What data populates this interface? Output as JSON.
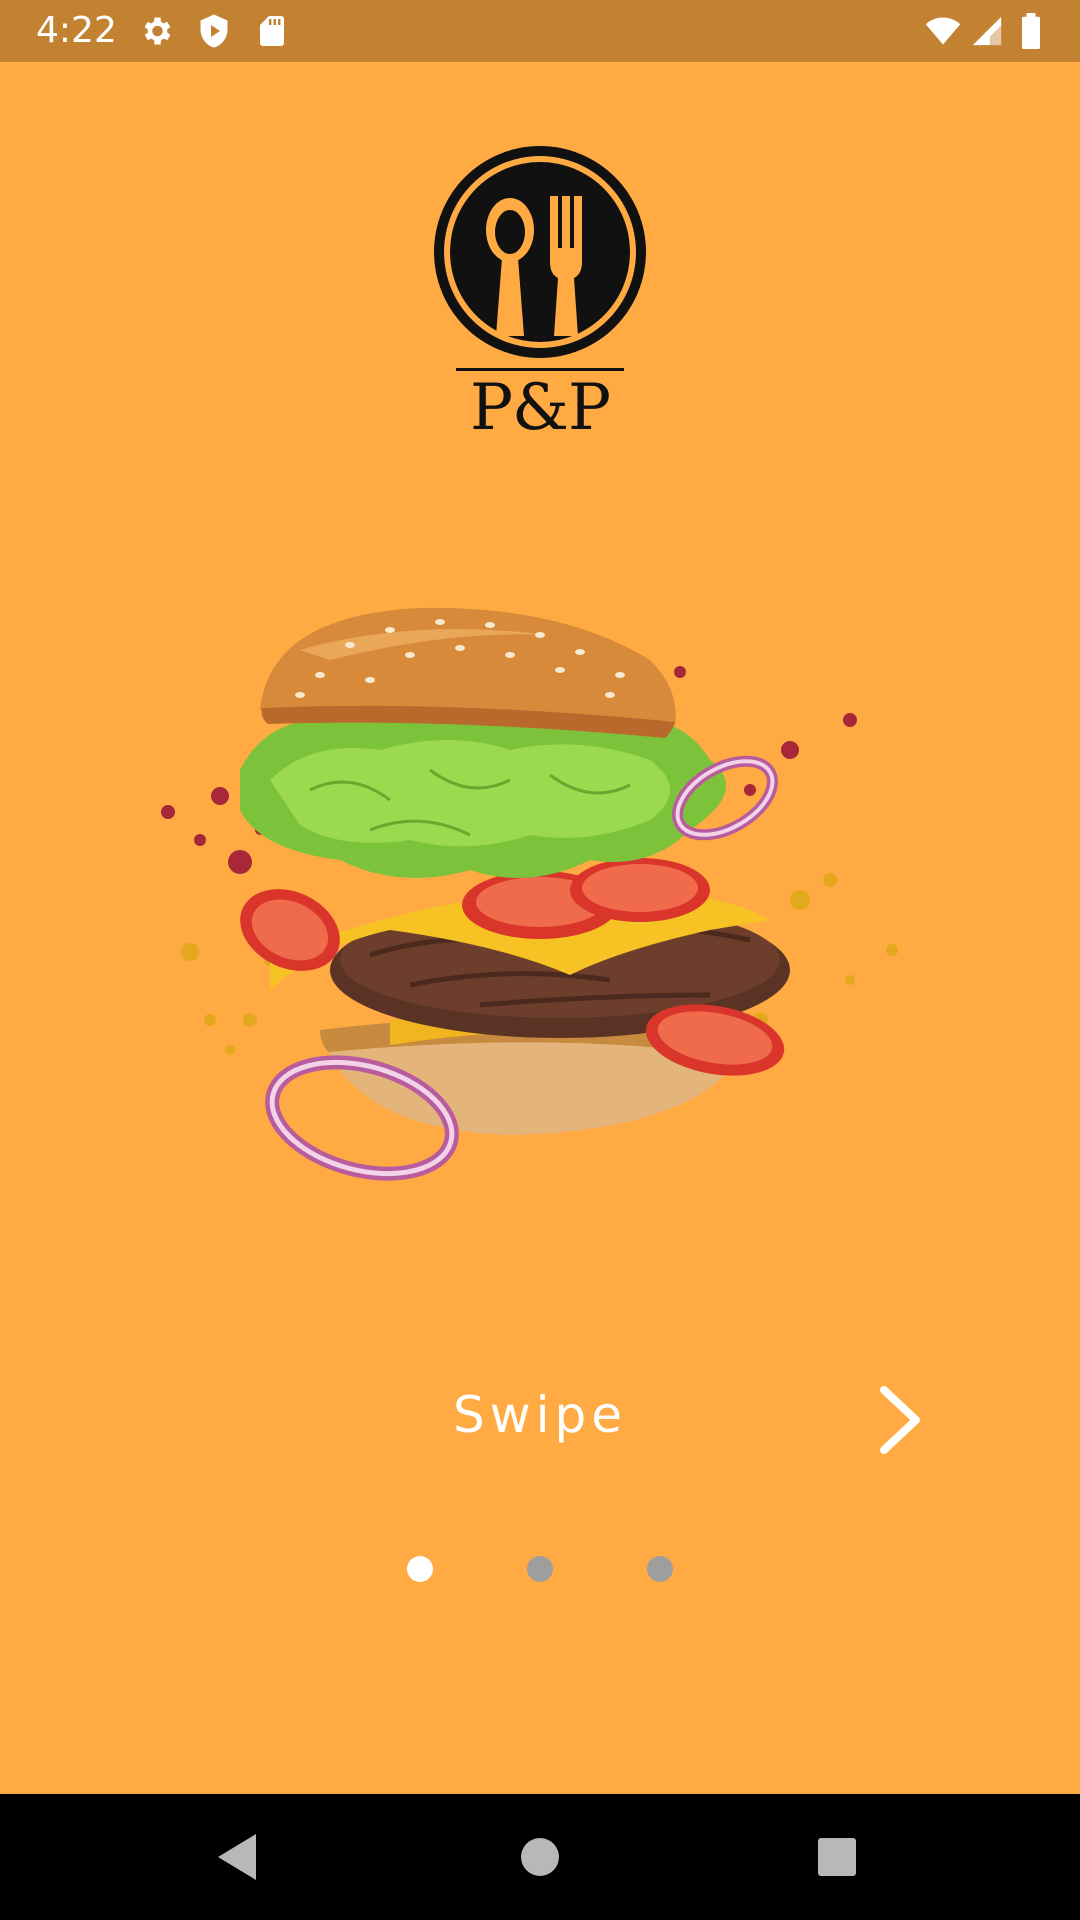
{
  "status_bar": {
    "time": "4:22",
    "background": "#C38232",
    "icons_left": [
      "gear-icon",
      "shield-play-icon",
      "sd-card-icon"
    ],
    "icons_right": [
      "wifi-icon",
      "signal-icon",
      "battery-icon"
    ]
  },
  "theme": {
    "background": "#FFAA42",
    "dot_active": "#FFFFFF",
    "dot_inactive": "#9E9E9E"
  },
  "logo": {
    "icon": "spoon-fork-icon",
    "text": "P&P"
  },
  "hero": {
    "icon": "burger-illustration"
  },
  "onboarding": {
    "swipe_label": "Swipe",
    "next_icon": "chevron-right-icon",
    "page_count": 3,
    "current_page": 1
  },
  "nav_bar": {
    "buttons": [
      "back-icon",
      "home-icon",
      "recents-icon"
    ]
  }
}
